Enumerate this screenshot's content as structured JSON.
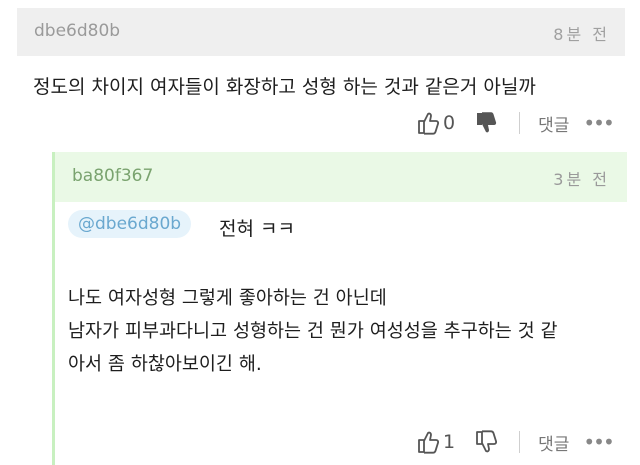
{
  "comment1": {
    "username": "dbe6d80b",
    "time": "8분 전",
    "body": "정도의 차이지 여자들이 화장하고 성형 하는 것과 같은거 아닐까",
    "like_count": "0",
    "reply_label": "댓글",
    "more": "•••"
  },
  "comment2": {
    "username": "ba80f367",
    "time": "3분 전",
    "mention": "@dbe6d80b",
    "reply_text": "전혀 ㅋㅋ",
    "body_lines": [
      "나도 여자성형 그렇게 좋아하는 건 아닌데",
      "남자가 피부과다니고 성형하는 건 뭔가 여성성을 추구하는 것 같",
      "아서 좀 하찮아보이긴 해."
    ],
    "like_count": "1",
    "reply_label": "댓글",
    "more": "•••"
  },
  "colors": {
    "header_gray": "#efefef",
    "reply_header_green": "#eaf9e6",
    "reply_bar_green": "#c8f0c0",
    "mention_bg": "#e6f3fb",
    "mention_text": "#6aa8cf"
  }
}
